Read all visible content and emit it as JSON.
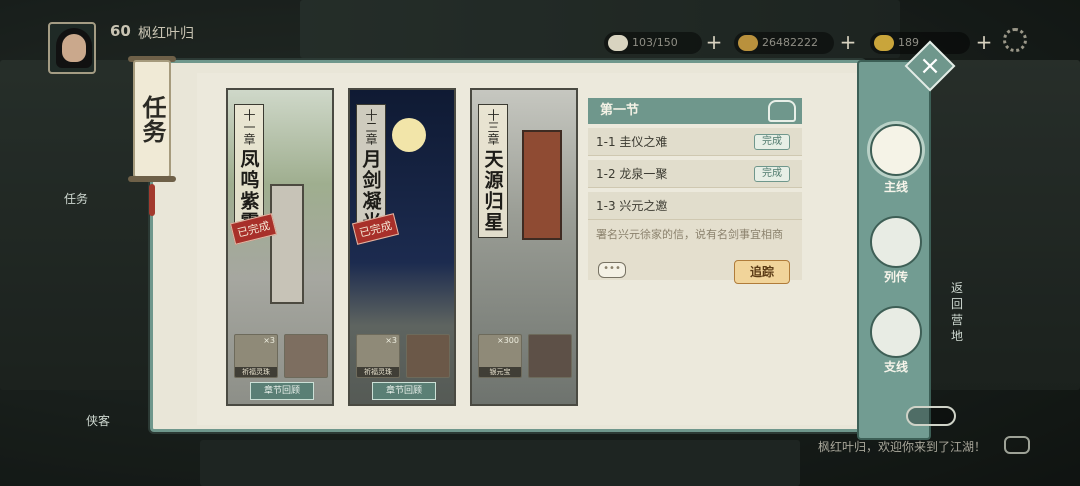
{
  "player": {
    "level": "60",
    "name": "枫红叶归"
  },
  "resources": [
    {
      "icon": "stamina-icon",
      "value": "103/150"
    },
    {
      "icon": "coin-icon",
      "value": "26482222"
    },
    {
      "icon": "ingot-icon",
      "value": "189"
    }
  ],
  "panel_title": "任务",
  "chapters": [
    {
      "num": "十一章",
      "name": "凤鸣紫霄",
      "status": "已完成",
      "rewards": [
        {
          "cap": "祈福灵珠",
          "qty": "×3"
        },
        {
          "cap": "",
          "qty": ""
        }
      ],
      "review": "章节回顾"
    },
    {
      "num": "十二章",
      "name": "月剑凝光",
      "status": "已完成",
      "rewards": [
        {
          "cap": "祈福灵珠",
          "qty": "×3"
        },
        {
          "cap": "",
          "qty": ""
        }
      ],
      "review": "章节回顾"
    },
    {
      "num": "十三章",
      "name": "天源归星",
      "status": "",
      "rewards": [
        {
          "cap": "银元宝",
          "qty": "×300"
        },
        {
          "cap": "",
          "qty": ""
        }
      ],
      "review": ""
    }
  ],
  "section": {
    "title": "第一节",
    "tasks": [
      {
        "label": "1-1 圭仪之难",
        "status": "完成"
      },
      {
        "label": "1-2 龙泉一聚",
        "status": "完成"
      },
      {
        "label": "1-3 兴元之邀",
        "status": ""
      }
    ],
    "desc": "署名兴元徐家的信，说有名剑事宜相商",
    "chat": "•••",
    "track": "追踪"
  },
  "tabs": [
    {
      "label": "主线",
      "icon": "main-quest-icon"
    },
    {
      "label": "列传",
      "icon": "biography-icon"
    },
    {
      "label": "支线",
      "icon": "side-quest-icon"
    }
  ],
  "side_labels": {
    "left_task": "任务",
    "left_bottom": "侠客",
    "return": "返回营地"
  },
  "chat_message": "枫红叶归，欢迎你来到了江湖！",
  "colors": {
    "accent": "#6f978c",
    "done_tag": "#a8302a",
    "track": "#f1d49a"
  }
}
